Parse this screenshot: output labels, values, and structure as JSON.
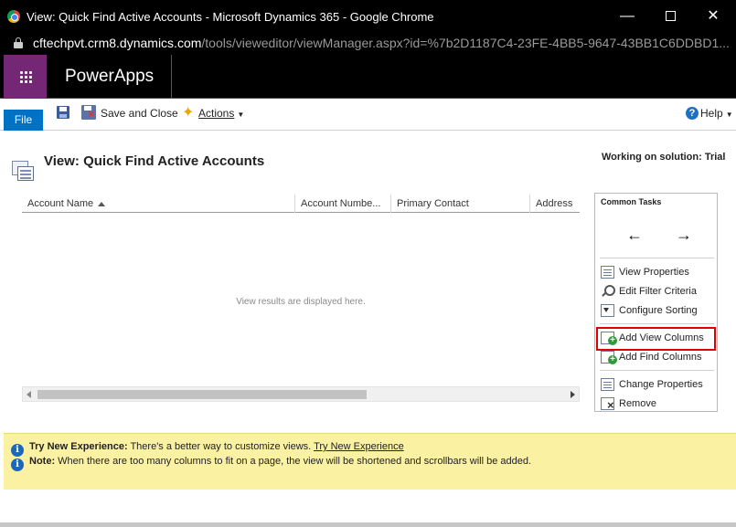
{
  "window": {
    "title": "View: Quick Find Active Accounts - Microsoft Dynamics 365 - Google Chrome",
    "minimize": "—",
    "close": "✕"
  },
  "address_bar": {
    "host": "cftechpvt.crm8.dynamics.com",
    "path": "/tools/vieweditor/viewManager.aspx?id=%7b2D1187C4-23FE-4BB5-9647-43BB1C6DDBD1..."
  },
  "app_header": {
    "app_name": "PowerApps"
  },
  "ribbon": {
    "file_tab": "File",
    "save_close": "Save and Close",
    "actions": "Actions",
    "help": "Help"
  },
  "page": {
    "title": "View: Quick Find Active Accounts",
    "solution": "Working on solution: Trial"
  },
  "grid": {
    "columns": [
      "Account Name",
      "Account Numbe...",
      "Primary Contact",
      "Address"
    ],
    "empty_message": "View results are displayed here."
  },
  "common_tasks": {
    "header": "Common Tasks",
    "back_arrow": "←",
    "forward_arrow": "→",
    "items": [
      {
        "label": "View Properties",
        "icon": "view-properties-icon"
      },
      {
        "label": "Edit Filter Criteria",
        "icon": "filter-icon"
      },
      {
        "label": "Configure Sorting",
        "icon": "sort-icon"
      },
      {
        "label": "Add View Columns",
        "icon": "add-column-icon",
        "highlighted": true
      },
      {
        "label": "Add Find Columns",
        "icon": "add-find-column-icon"
      },
      {
        "label": "Change Properties",
        "icon": "change-properties-icon"
      },
      {
        "label": "Remove",
        "icon": "remove-icon"
      }
    ]
  },
  "notifications": {
    "try_label": "Try New Experience:",
    "try_text": " There's a better way to customize views. ",
    "try_link": "Try New Experience",
    "note_label": "Note:",
    "note_text": " When there are too many columns to fit on a page, the view will be shortened and scrollbars will be added."
  },
  "colors": {
    "accent_purple": "#742774",
    "file_blue": "#0072c6",
    "highlight_red": "#e00000",
    "notify_yellow": "#fbf1a3"
  }
}
